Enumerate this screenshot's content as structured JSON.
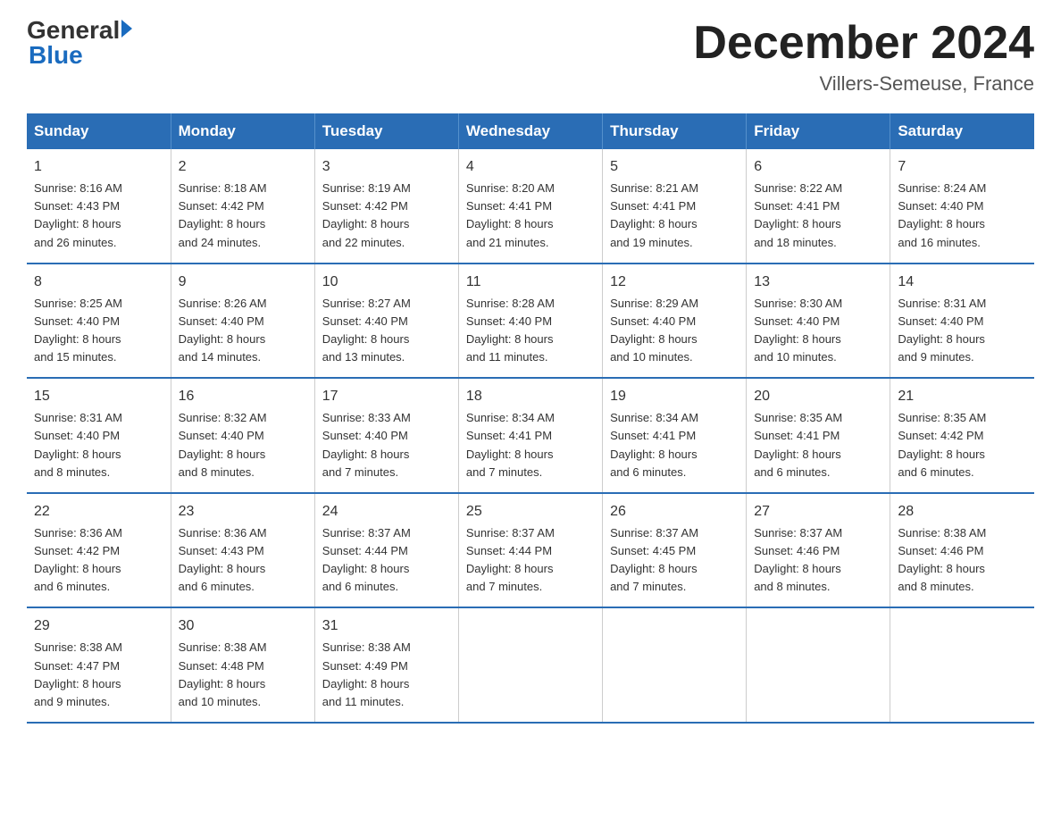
{
  "logo": {
    "general": "General",
    "blue": "Blue",
    "tagline": "Blue"
  },
  "title": {
    "month_year": "December 2024",
    "location": "Villers-Semeuse, France"
  },
  "weekdays": [
    "Sunday",
    "Monday",
    "Tuesday",
    "Wednesday",
    "Thursday",
    "Friday",
    "Saturday"
  ],
  "weeks": [
    [
      {
        "day": "1",
        "info": "Sunrise: 8:16 AM\nSunset: 4:43 PM\nDaylight: 8 hours\nand 26 minutes."
      },
      {
        "day": "2",
        "info": "Sunrise: 8:18 AM\nSunset: 4:42 PM\nDaylight: 8 hours\nand 24 minutes."
      },
      {
        "day": "3",
        "info": "Sunrise: 8:19 AM\nSunset: 4:42 PM\nDaylight: 8 hours\nand 22 minutes."
      },
      {
        "day": "4",
        "info": "Sunrise: 8:20 AM\nSunset: 4:41 PM\nDaylight: 8 hours\nand 21 minutes."
      },
      {
        "day": "5",
        "info": "Sunrise: 8:21 AM\nSunset: 4:41 PM\nDaylight: 8 hours\nand 19 minutes."
      },
      {
        "day": "6",
        "info": "Sunrise: 8:22 AM\nSunset: 4:41 PM\nDaylight: 8 hours\nand 18 minutes."
      },
      {
        "day": "7",
        "info": "Sunrise: 8:24 AM\nSunset: 4:40 PM\nDaylight: 8 hours\nand 16 minutes."
      }
    ],
    [
      {
        "day": "8",
        "info": "Sunrise: 8:25 AM\nSunset: 4:40 PM\nDaylight: 8 hours\nand 15 minutes."
      },
      {
        "day": "9",
        "info": "Sunrise: 8:26 AM\nSunset: 4:40 PM\nDaylight: 8 hours\nand 14 minutes."
      },
      {
        "day": "10",
        "info": "Sunrise: 8:27 AM\nSunset: 4:40 PM\nDaylight: 8 hours\nand 13 minutes."
      },
      {
        "day": "11",
        "info": "Sunrise: 8:28 AM\nSunset: 4:40 PM\nDaylight: 8 hours\nand 11 minutes."
      },
      {
        "day": "12",
        "info": "Sunrise: 8:29 AM\nSunset: 4:40 PM\nDaylight: 8 hours\nand 10 minutes."
      },
      {
        "day": "13",
        "info": "Sunrise: 8:30 AM\nSunset: 4:40 PM\nDaylight: 8 hours\nand 10 minutes."
      },
      {
        "day": "14",
        "info": "Sunrise: 8:31 AM\nSunset: 4:40 PM\nDaylight: 8 hours\nand 9 minutes."
      }
    ],
    [
      {
        "day": "15",
        "info": "Sunrise: 8:31 AM\nSunset: 4:40 PM\nDaylight: 8 hours\nand 8 minutes."
      },
      {
        "day": "16",
        "info": "Sunrise: 8:32 AM\nSunset: 4:40 PM\nDaylight: 8 hours\nand 8 minutes."
      },
      {
        "day": "17",
        "info": "Sunrise: 8:33 AM\nSunset: 4:40 PM\nDaylight: 8 hours\nand 7 minutes."
      },
      {
        "day": "18",
        "info": "Sunrise: 8:34 AM\nSunset: 4:41 PM\nDaylight: 8 hours\nand 7 minutes."
      },
      {
        "day": "19",
        "info": "Sunrise: 8:34 AM\nSunset: 4:41 PM\nDaylight: 8 hours\nand 6 minutes."
      },
      {
        "day": "20",
        "info": "Sunrise: 8:35 AM\nSunset: 4:41 PM\nDaylight: 8 hours\nand 6 minutes."
      },
      {
        "day": "21",
        "info": "Sunrise: 8:35 AM\nSunset: 4:42 PM\nDaylight: 8 hours\nand 6 minutes."
      }
    ],
    [
      {
        "day": "22",
        "info": "Sunrise: 8:36 AM\nSunset: 4:42 PM\nDaylight: 8 hours\nand 6 minutes."
      },
      {
        "day": "23",
        "info": "Sunrise: 8:36 AM\nSunset: 4:43 PM\nDaylight: 8 hours\nand 6 minutes."
      },
      {
        "day": "24",
        "info": "Sunrise: 8:37 AM\nSunset: 4:44 PM\nDaylight: 8 hours\nand 6 minutes."
      },
      {
        "day": "25",
        "info": "Sunrise: 8:37 AM\nSunset: 4:44 PM\nDaylight: 8 hours\nand 7 minutes."
      },
      {
        "day": "26",
        "info": "Sunrise: 8:37 AM\nSunset: 4:45 PM\nDaylight: 8 hours\nand 7 minutes."
      },
      {
        "day": "27",
        "info": "Sunrise: 8:37 AM\nSunset: 4:46 PM\nDaylight: 8 hours\nand 8 minutes."
      },
      {
        "day": "28",
        "info": "Sunrise: 8:38 AM\nSunset: 4:46 PM\nDaylight: 8 hours\nand 8 minutes."
      }
    ],
    [
      {
        "day": "29",
        "info": "Sunrise: 8:38 AM\nSunset: 4:47 PM\nDaylight: 8 hours\nand 9 minutes."
      },
      {
        "day": "30",
        "info": "Sunrise: 8:38 AM\nSunset: 4:48 PM\nDaylight: 8 hours\nand 10 minutes."
      },
      {
        "day": "31",
        "info": "Sunrise: 8:38 AM\nSunset: 4:49 PM\nDaylight: 8 hours\nand 11 minutes."
      },
      {
        "day": "",
        "info": ""
      },
      {
        "day": "",
        "info": ""
      },
      {
        "day": "",
        "info": ""
      },
      {
        "day": "",
        "info": ""
      }
    ]
  ]
}
